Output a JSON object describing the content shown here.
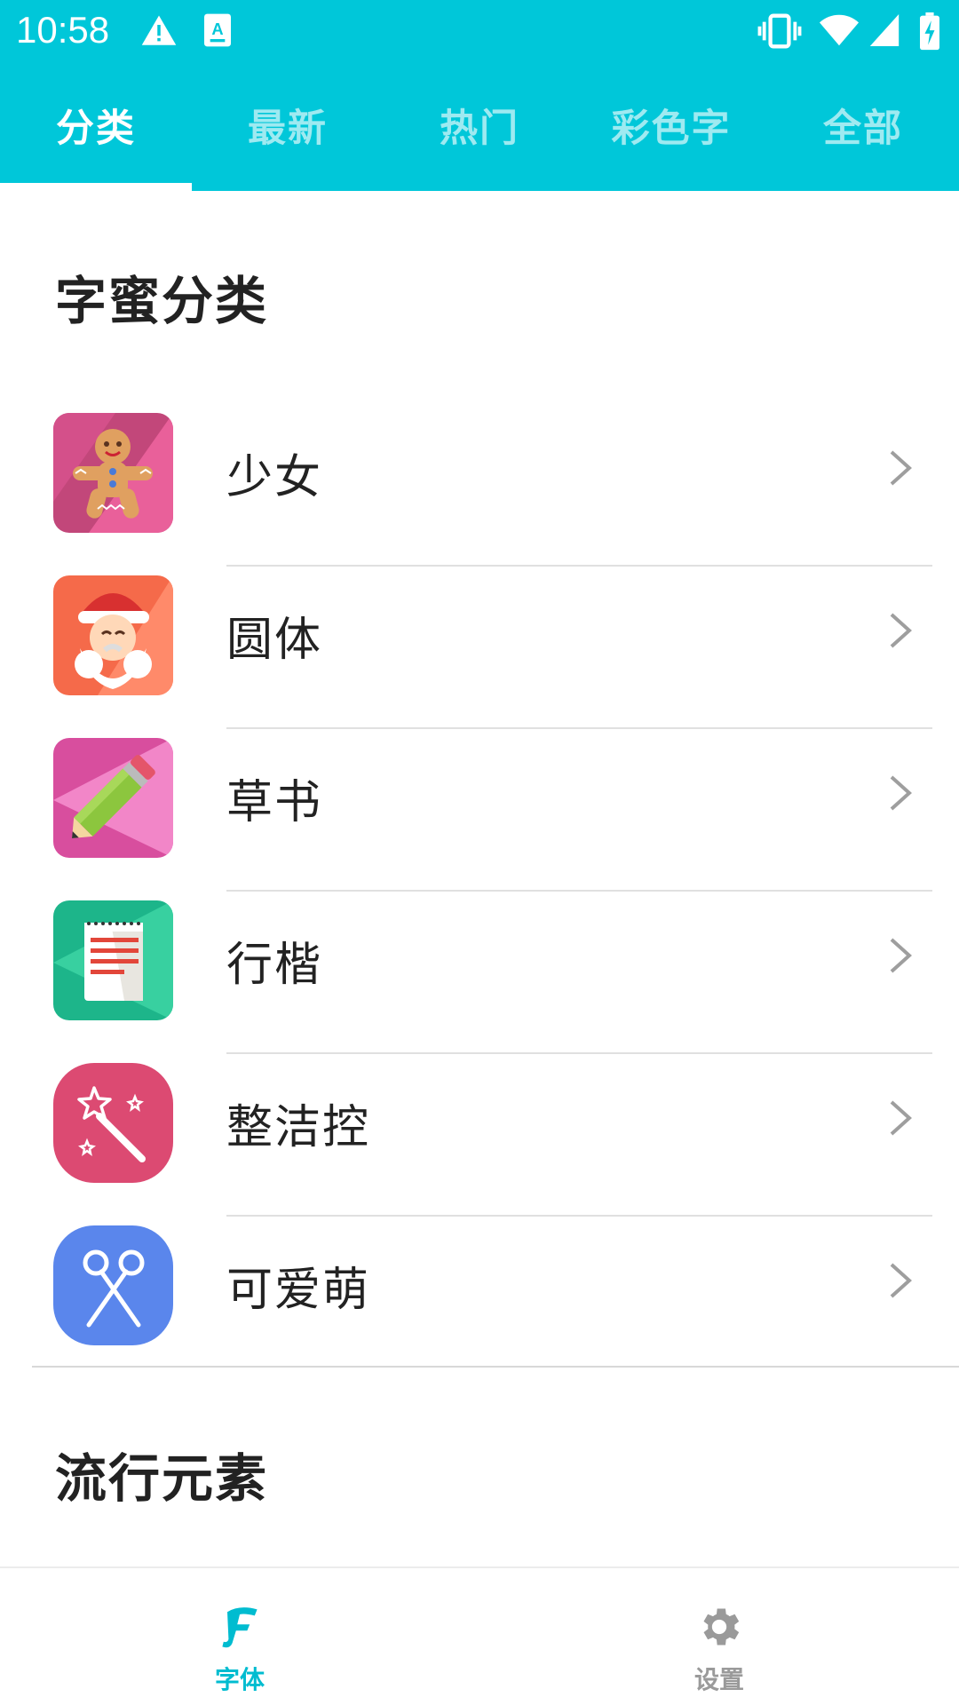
{
  "status_bar": {
    "time": "10:58",
    "icons": [
      "warning-icon",
      "keyboard-a-icon",
      "vibrate-icon",
      "wifi-icon",
      "signal-icon",
      "battery-charging-icon"
    ]
  },
  "colors": {
    "accent": "#00C7D9",
    "nav_active": "#00BCD0",
    "nav_inactive": "#9a9a9a"
  },
  "tabs": [
    {
      "label": "分类",
      "active": true
    },
    {
      "label": "最新",
      "active": false
    },
    {
      "label": "热门",
      "active": false
    },
    {
      "label": "彩色字",
      "active": false
    },
    {
      "label": "全部",
      "active": false
    }
  ],
  "category_section": {
    "title": "字蜜分类",
    "items": [
      {
        "label": "少女",
        "icon": "gingerbread-icon"
      },
      {
        "label": "圆体",
        "icon": "santa-icon"
      },
      {
        "label": "草书",
        "icon": "pencil-icon"
      },
      {
        "label": "行楷",
        "icon": "notepad-icon"
      },
      {
        "label": "整洁控",
        "icon": "magic-wand-icon"
      },
      {
        "label": "可爱萌",
        "icon": "scissors-icon"
      }
    ]
  },
  "trend_section": {
    "title": "流行元素"
  },
  "bottom_nav": [
    {
      "label": "字体",
      "icon": "font-f-icon",
      "active": true
    },
    {
      "label": "设置",
      "icon": "gear-icon",
      "active": false
    }
  ]
}
